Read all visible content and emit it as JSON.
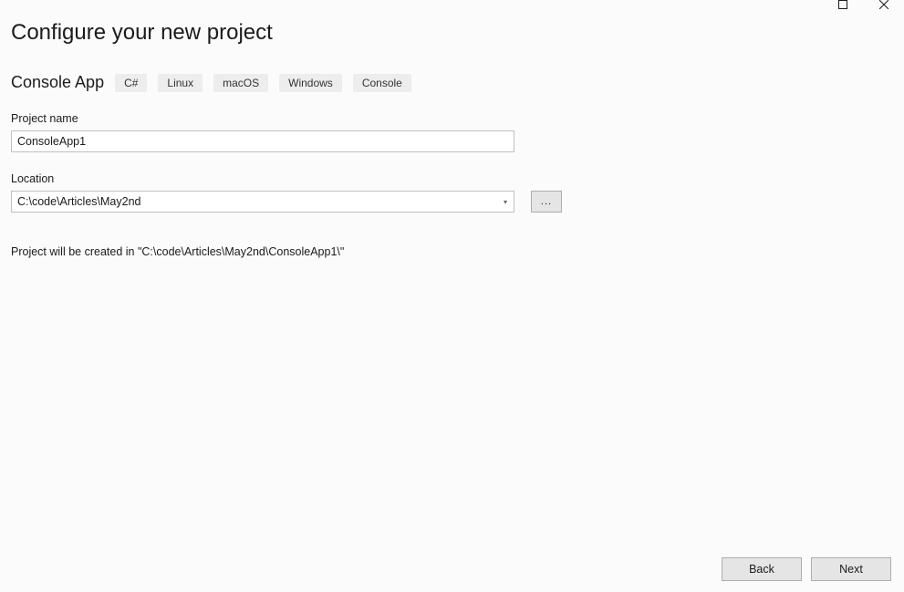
{
  "window": {
    "title": "Configure your new project"
  },
  "template": {
    "name": "Console App",
    "tags": [
      "C#",
      "Linux",
      "macOS",
      "Windows",
      "Console"
    ]
  },
  "fields": {
    "project_name_label": "Project name",
    "project_name_value": "ConsoleApp1",
    "location_label": "Location",
    "location_value": "C:\\code\\Articles\\May2nd",
    "browse_label": "..."
  },
  "info": {
    "created_in_text": "Project will be created in \"C:\\code\\Articles\\May2nd\\ConsoleApp1\\\""
  },
  "footer": {
    "back_label": "Back",
    "next_label": "Next"
  }
}
